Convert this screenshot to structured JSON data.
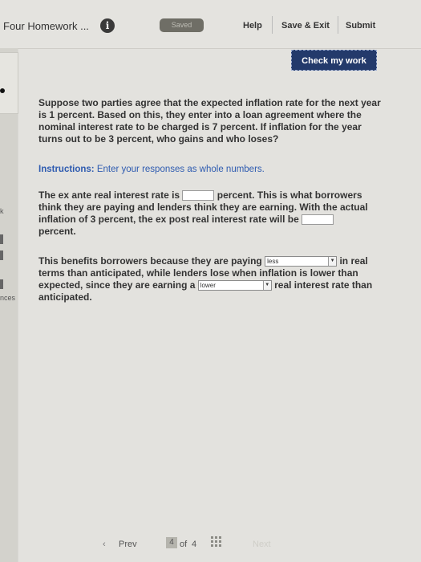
{
  "header": {
    "assignment_title": "Four Homework ...",
    "info_icon": "i",
    "saved_badge": "Saved",
    "help": "Help",
    "save_exit": "Save & Exit",
    "submit": "Submit"
  },
  "sidebar": {
    "fragment_1": "k",
    "fragment_2": "nces"
  },
  "check_button": "Check my work",
  "question": "Suppose two parties agree that the expected inflation rate for the next year is 1 percent. Based on this, they enter into a loan agreement where the nominal interest rate to be charged is 7 percent. If inflation for the year turns out to be 3 percent, who gains and who loses?",
  "instructions": {
    "label": "Instructions:",
    "text": " Enter your responses as whole numbers."
  },
  "para1": {
    "s1": "The ex ante real interest rate is",
    "s2": "percent. This is what borrowers think they are paying and lenders think they are earning. With the actual inflation of 3 percent, the ex post real interest rate will be",
    "s3": "percent.",
    "ex_ante_value": "",
    "ex_post_value": ""
  },
  "para2": {
    "s1": "This benefits borrowers because they are paying",
    "dropdown1_selected": "less",
    "s2": "in real terms than anticipated, while lenders lose when inflation is lower than expected, since they are earning a",
    "dropdown2_selected": "lower",
    "s3": "real interest rate than anticipated."
  },
  "footer": {
    "prev": "Prev",
    "current_page": "4",
    "of": "of",
    "total_pages": "4",
    "next": "Next"
  }
}
